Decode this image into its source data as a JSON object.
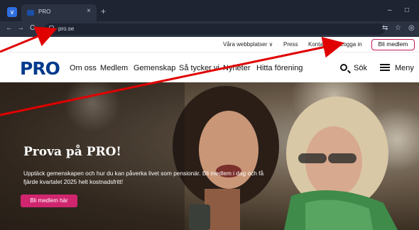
{
  "browser": {
    "tab_title": "PRO",
    "new_tab_icon": "+",
    "close_tab_icon": "×",
    "url": "pro.se",
    "back_icon": "←",
    "forward_icon": "→",
    "reload_icon": "C",
    "minimize_icon": "–",
    "maximize_icon": "□",
    "translate_icon": "⇆",
    "star_icon": "☆",
    "profile_icon": "◎"
  },
  "utility_nav": {
    "sites_label": "Våra webbplatser ∨",
    "press_label": "Press",
    "contact_label": "Kontakt",
    "login_label": "Logga in",
    "join_label": "Bli medlem"
  },
  "main_nav": {
    "logo": "PRO",
    "items": [
      "Om oss",
      "Medlem",
      "Gemenskap",
      "Så tycker vi",
      "Nyheter",
      "Hitta förening"
    ],
    "search_label": "Sök",
    "menu_label": "Meny"
  },
  "hero": {
    "title": "Prova på PRO!",
    "text": "Upptäck gemenskapen och hur du kan påverka livet som pensionär. Bli medlem i dag och få fjärde kvartalet 2025 helt kostnadsfritt!",
    "cta_label": "Bli medlem här"
  },
  "colors": {
    "brand_blue": "#003a8c",
    "accent_pink": "#d0266f",
    "annotation_red": "#e00000"
  }
}
